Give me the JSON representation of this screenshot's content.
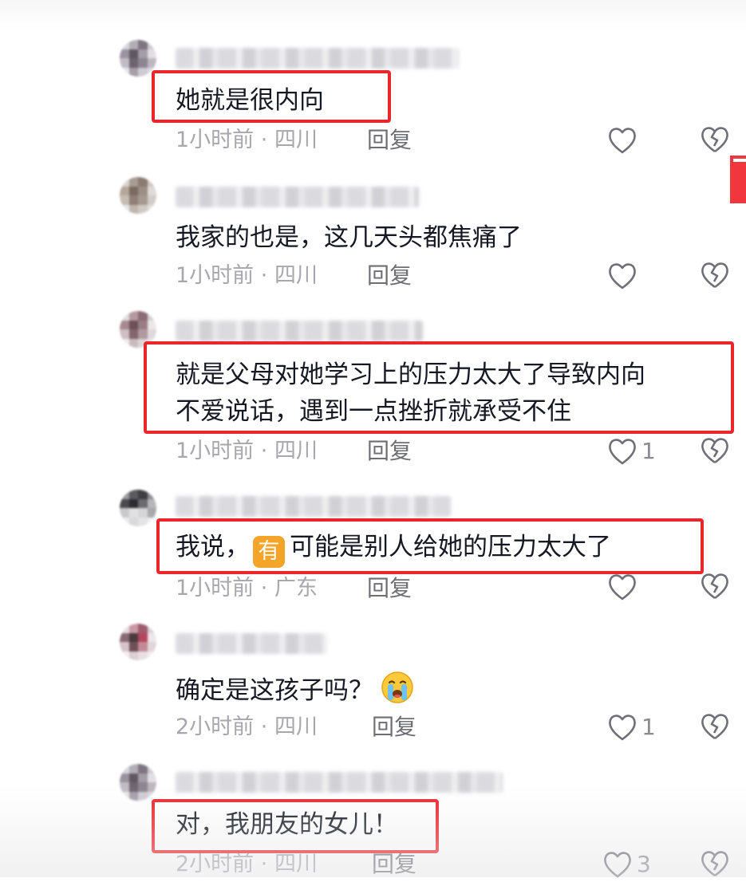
{
  "comments": [
    {
      "text": "她就是很内向",
      "time": "1小时前",
      "location": "四川",
      "reply_label": "回复",
      "like_count": ""
    },
    {
      "text": "我家的也是，这几天头都焦痛了",
      "time": "1小时前",
      "location": "四川",
      "reply_label": "回复",
      "like_count": ""
    },
    {
      "text_line1": "就是父母对她学习上的压力太大了导致内向",
      "text_line2": "不爱说话，遇到一点挫折就承受不住",
      "time": "1小时前",
      "location": "四川",
      "reply_label": "回复",
      "like_count": "1"
    },
    {
      "text_prefix": "我说，",
      "emoji": "有",
      "text_suffix": "可能是别人给她的压力太大了",
      "time": "1小时前",
      "location": "广东",
      "reply_label": "回复",
      "like_count": ""
    },
    {
      "text": "确定是这孩子吗？",
      "emoji": "crying-face",
      "time": "2小时前",
      "location": "四川",
      "reply_label": "回复",
      "like_count": "1"
    },
    {
      "text": "对，我朋友的女儿！",
      "time": "2小时前",
      "location": "四川",
      "reply_label": "回复",
      "like_count": "3"
    }
  ],
  "meta_separator": "·",
  "colors": {
    "highlight_box": "#e8262c",
    "meta_text": "#a7a7ad",
    "body_text": "#161823",
    "emoji_badge": "#f5a42a"
  },
  "icons": {
    "like": "heart-outline-icon",
    "dislike": "broken-heart-outline-icon"
  }
}
